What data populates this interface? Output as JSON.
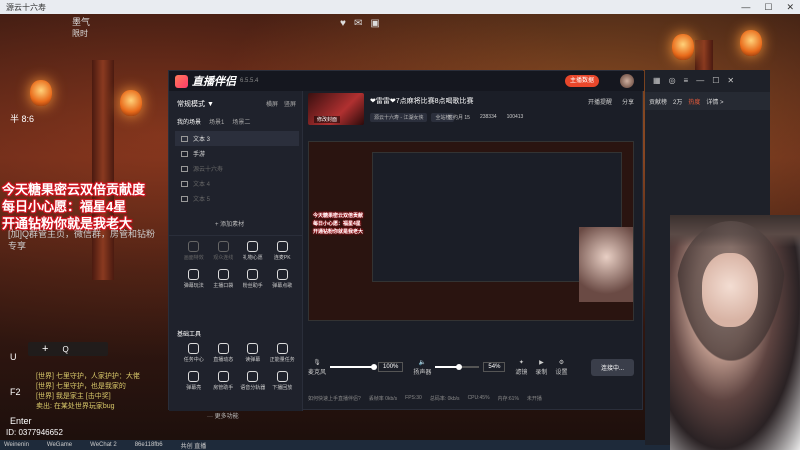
{
  "outer_window": {
    "title": "源云十六寿"
  },
  "streamer": {
    "name": "墨气",
    "level": "限时",
    "top_text": "半 8:6"
  },
  "top_icons": [
    "heart-icon",
    "chat-icon",
    "tv-icon"
  ],
  "overlay": {
    "line1": "今天糖果密云双倍贡献度",
    "line2": "每日小心愿：福星4星",
    "line3": "开通钻粉你就是我老大",
    "gray_line1": "[加]Q群管主页，微信群，房管和钻粉",
    "gray_line2": "专享"
  },
  "hud": {
    "key_u": "U",
    "key_f2": "F2",
    "key_enter": "Enter",
    "plus": "+",
    "search": "Q"
  },
  "game_chat": [
    "[世界] 七里守护，人家护护：大佬",
    "[世界] 七里守护，也是我家的",
    "[世界] 我是家主 [击中奖]",
    "卖出: 在某处世界玩家bug"
  ],
  "user_id": "ID: 0377946652",
  "taskbar": [
    "Weinenin",
    "WeGame",
    "WeChat 2",
    "86e118fb6",
    "共创 直播"
  ],
  "app": {
    "title": "直播伴侣",
    "version": "6.5.5.4",
    "live_badge": "主播数据",
    "left": {
      "mode": "常规模式 ▼",
      "mode_links": [
        "横屏",
        "竖屏"
      ],
      "scene_tabs": [
        "我的场景",
        "场景1",
        "场景二"
      ],
      "sources": [
        {
          "label": "文本 3",
          "selected": true
        },
        {
          "label": "手游",
          "selected": false
        },
        {
          "label": "源云十六寿",
          "selected": false,
          "dim": true
        },
        {
          "label": "文本 4",
          "selected": false,
          "dim": true
        },
        {
          "label": "文本 5",
          "selected": false,
          "dim": true
        }
      ],
      "add_source": "+ 添加素材",
      "interact_tools": [
        {
          "label": "画面特效",
          "dim": true
        },
        {
          "label": "观众连线",
          "dim": true
        },
        {
          "label": "礼物心愿",
          "dim": false
        },
        {
          "label": "连麦PK",
          "dim": false
        },
        {
          "label": "弹幕玩法",
          "dim": false
        },
        {
          "label": "主播口袋",
          "dim": false
        },
        {
          "label": "粉丝助手",
          "dim": false
        },
        {
          "label": "弹幕点歌",
          "dim": false
        }
      ],
      "basic_tools_title": "基础工具",
      "basic_tools": [
        {
          "label": "任务中心",
          "dim": false
        },
        {
          "label": "直播动态",
          "dim": false
        },
        {
          "label": "读弹幕",
          "dim": false
        },
        {
          "label": "正能量任务",
          "dim": false
        },
        {
          "label": "弹幕亮",
          "dim": false
        },
        {
          "label": "房管助手",
          "dim": false
        },
        {
          "label": "语音分轨器",
          "dim": false
        },
        {
          "label": "下播回放",
          "dim": false
        }
      ],
      "more_features": "··· 更多功能"
    },
    "room": {
      "cover_label": "修改封面",
      "title": "❤雷雷❤7点麻将比赛8点喝歌比赛",
      "tags": [
        "源云十六寿 - 江湖女侠",
        "全站榜"
      ],
      "stats": [
        "签约月 15",
        "238334",
        "100413"
      ],
      "links": [
        "开播提醒",
        "分享"
      ]
    },
    "preview": {
      "mini1": "今天糖果密云双倍贡献",
      "mini2": "每日小心愿：福星4星",
      "mini3": "开通钻粉你就是我老大"
    },
    "controls": {
      "mic_label": "麦克风",
      "mic_value": "100%",
      "mic_fraction": 1.0,
      "speaker_label": "扬声器",
      "speaker_value": "54%",
      "speaker_fraction": 0.54,
      "tools": [
        "滤镜",
        "录制",
        "设置"
      ],
      "connect": "连接中..."
    },
    "status": [
      "如何快速上手直播伴侣?",
      "丢帧率 0kb/s",
      "FPS:30",
      "总码率: 0kb/s",
      "CPU:45%",
      "内存:61%",
      "未开播"
    ]
  },
  "side_window": {
    "header_icons": [
      "grid-icon",
      "headset-icon",
      "list-icon",
      "minimize-icon",
      "maximize-icon",
      "close-icon"
    ],
    "tabs": [
      "贡献榜",
      "2万",
      "热度",
      "详情 >"
    ]
  }
}
